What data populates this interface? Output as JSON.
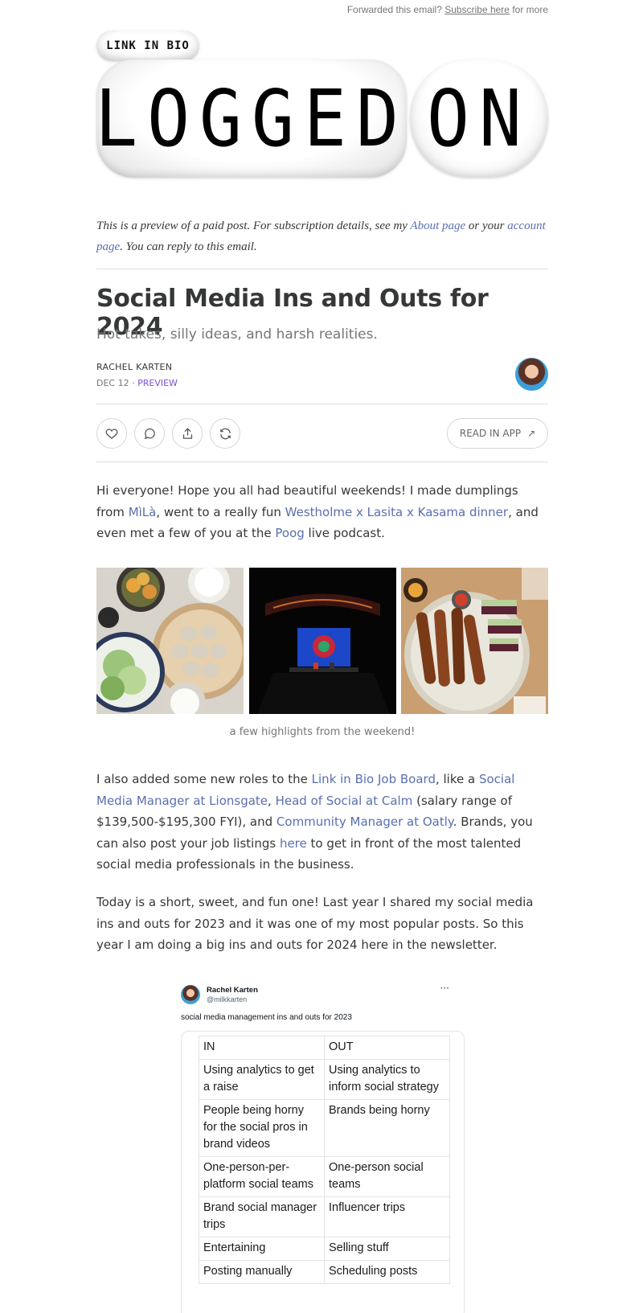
{
  "topbar": {
    "prefix": "Forwarded this email?",
    "link": "Subscribe here",
    "suffix": "for more"
  },
  "logo": {
    "small": "LINK IN BIO",
    "word1": "LOGGED",
    "word2": "ON"
  },
  "preview_note": {
    "part1": "This is a preview of a paid post. For subscription details, see my ",
    "about_link": "About page",
    "part2": " or your ",
    "account_link": "account page",
    "part3": ". You can reply to this email."
  },
  "post": {
    "title": "Social Media Ins and Outs for 2024",
    "subtitle": "Hot takes, silly ideas, and harsh realities.",
    "author": "RACHEL KARTEN",
    "date": "DEC 12",
    "separator": "·",
    "preview_label": "PREVIEW"
  },
  "actions": {
    "like_icon": "heart-icon",
    "comment_icon": "comment-icon",
    "share_icon": "share-icon",
    "restack_icon": "restack-icon",
    "read_in_app": "READ IN APP",
    "read_icon": "↗"
  },
  "body": {
    "p1": {
      "t1": "Hi everyone! Hope you all had beautiful weekends! I made dumplings from ",
      "l1": "MìLà",
      "t2": ", went to a really fun ",
      "l2": "Westholme x Lasita x Kasama dinner",
      "t3": ", and even met a few of you at the ",
      "l3": "Poog",
      "t4": " live podcast."
    },
    "caption": "a few highlights from the weekend!",
    "p2": {
      "t1": "I also added some new roles to the ",
      "l1": "Link in Bio Job Board",
      "t2": ", like a ",
      "l2": "Social Media Manager at Lionsgate",
      "t3": ", ",
      "l3": "Head of Social at Calm",
      "t4": " (salary range of $139,500-$195,300 FYI), and ",
      "l4": "Community Manager at Oatly",
      "t5": ". Brands, you can also post your job listings ",
      "l5": "here",
      "t6": " to get in front of the most talented social media professionals in the business."
    },
    "p3": "Today is a short, sweet, and fun one! Last year I shared my social media ins and outs for 2023 and it was one of my most popular posts. So this year I am doing a big ins and outs for 2024 here in the newsletter."
  },
  "tweet": {
    "name": "Rachel Karten",
    "handle": "@milkkarten",
    "more": "···",
    "text": "social media management ins and outs for 2023",
    "table": {
      "headers": [
        "IN",
        "OUT"
      ],
      "rows": [
        [
          "Using analytics to get a raise",
          "Using analytics to inform social strategy"
        ],
        [
          "People being horny for the social pros in brand videos",
          "Brands being horny"
        ],
        [
          "One-person-per-platform social teams",
          "One-person social teams"
        ],
        [
          "Brand social manager trips",
          "Influencer trips"
        ],
        [
          "Entertaining",
          "Selling stuff"
        ],
        [
          "Posting manually",
          "Scheduling posts"
        ]
      ]
    }
  },
  "colors": {
    "link": "#5a6fb0",
    "preview": "#7b4ed1",
    "text": "#363737"
  }
}
